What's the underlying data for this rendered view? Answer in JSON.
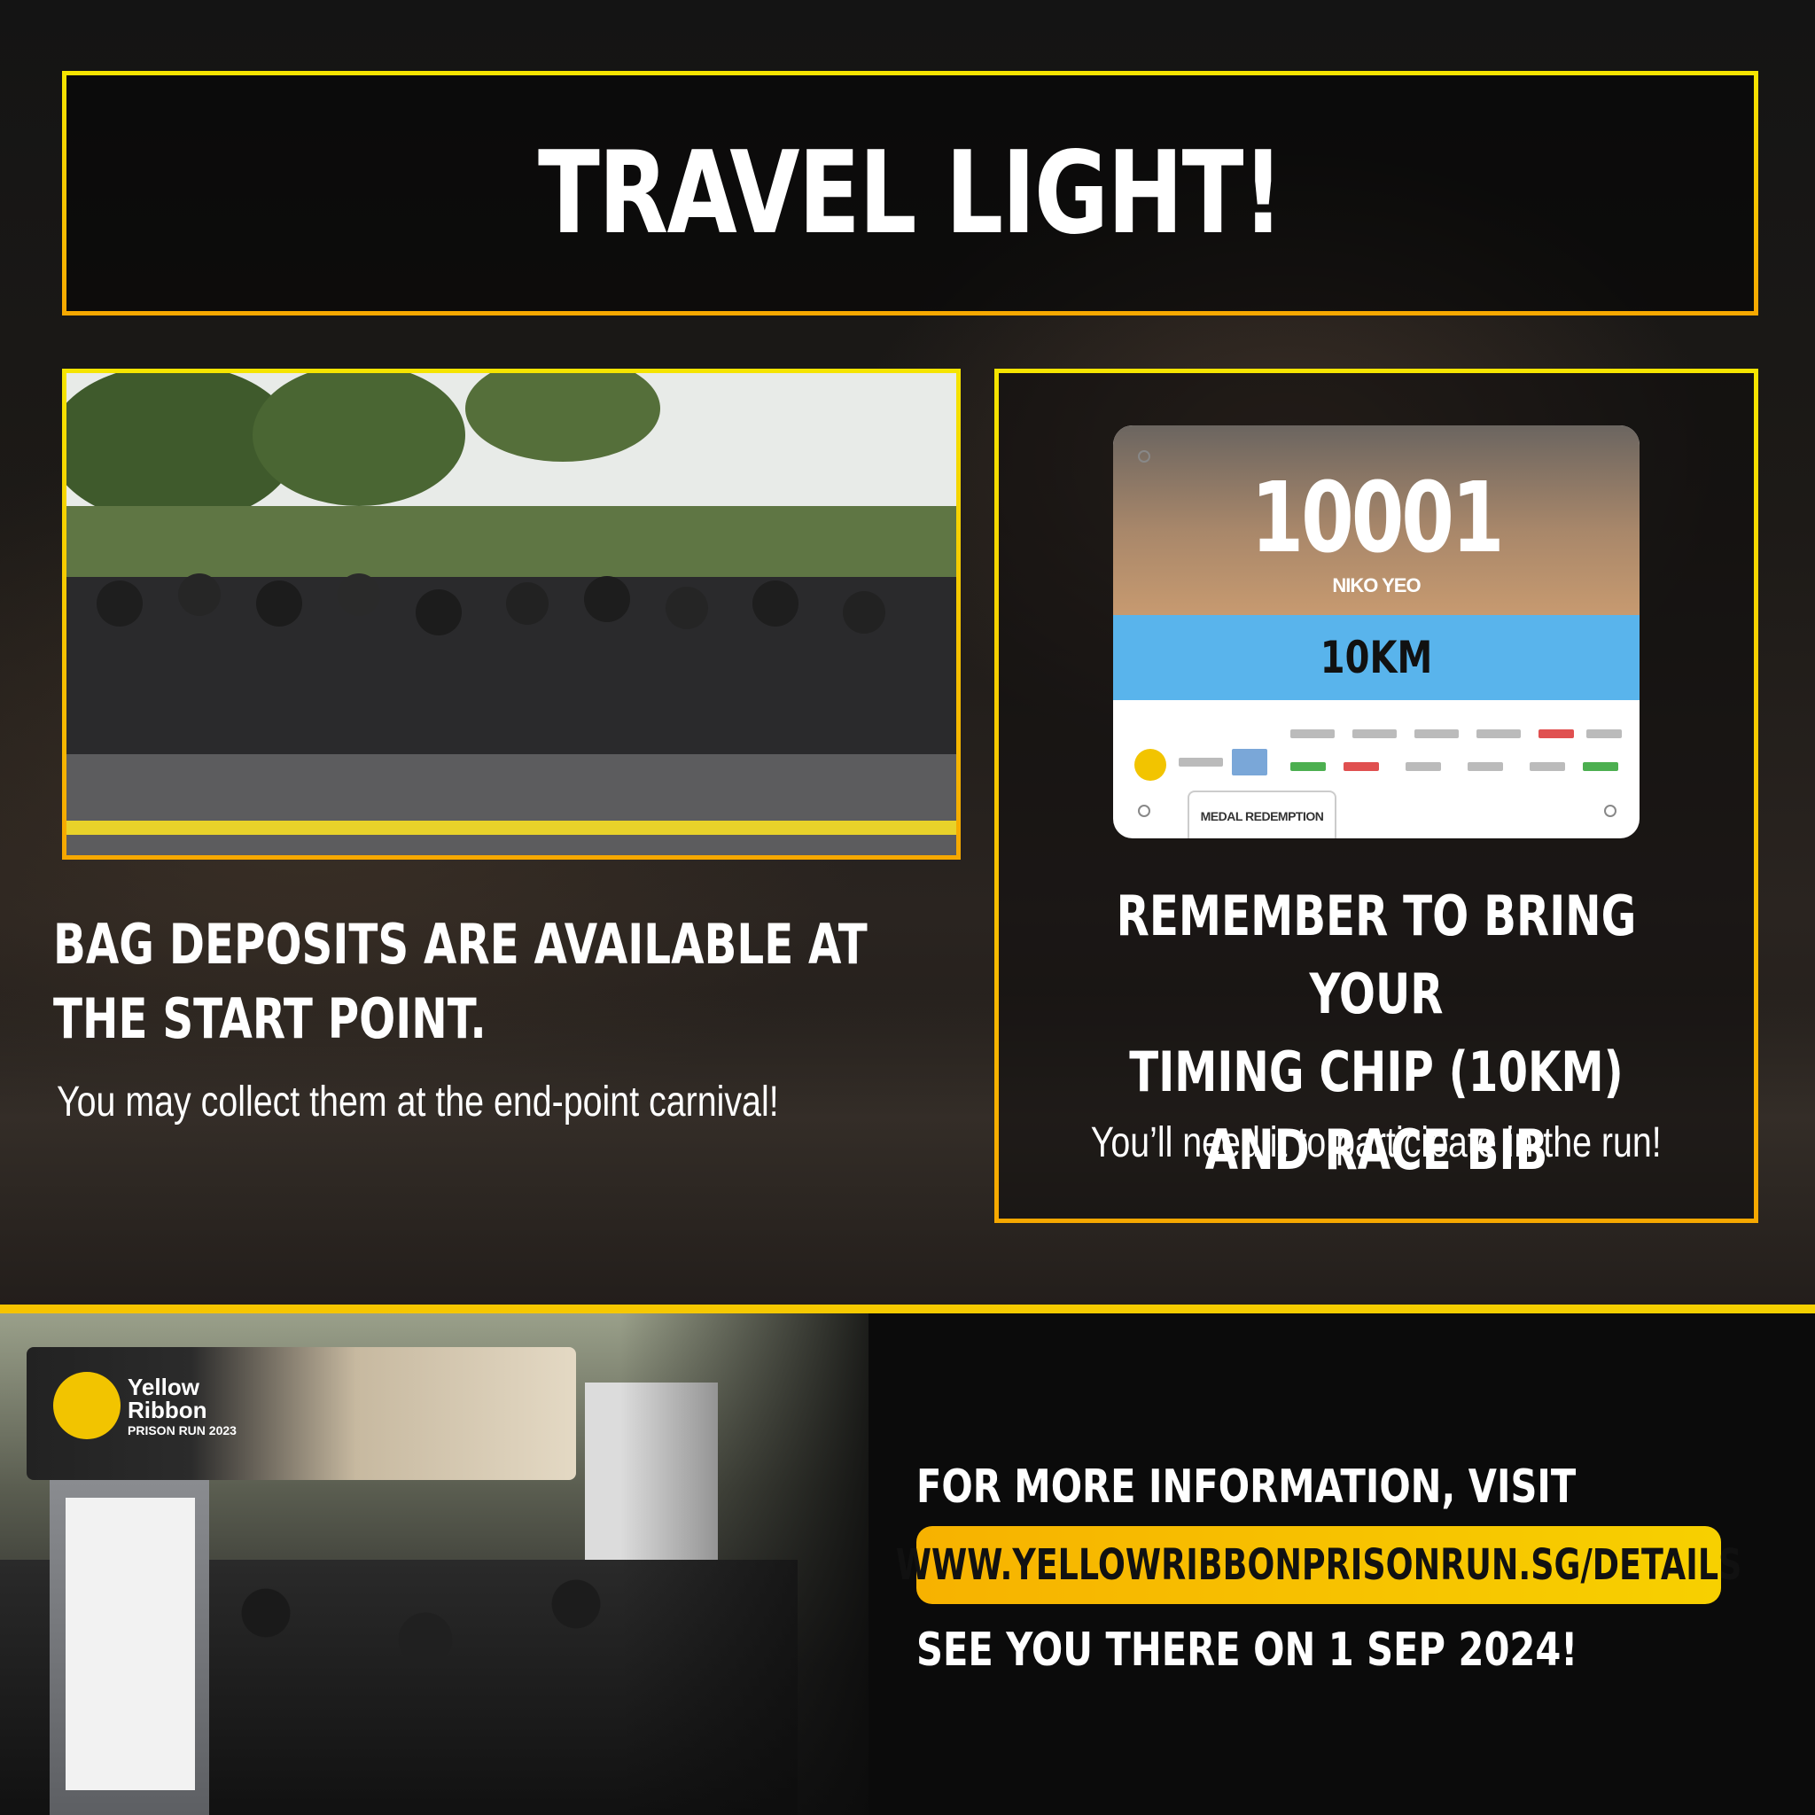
{
  "title": "TRAVEL LIGHT!",
  "bag": {
    "heading_line1": "BAG DEPOSITS ARE AVAILABLE AT",
    "heading_line2": "THE START POINT.",
    "subtext": "You may collect them at the end-point carnival!"
  },
  "bib_card": {
    "number": "10001",
    "name": "NIKO YEO",
    "distance": "10KM",
    "tab_label": "MEDAL REDEMPTION"
  },
  "chip": {
    "heading_line1": "REMEMBER TO BRING YOUR",
    "heading_line2": "TIMING CHIP (10KM)",
    "heading_line3": "AND RACE BIB",
    "subtext": "You’ll need it to participate in the run!"
  },
  "footer": {
    "info_line": "FOR MORE INFORMATION, VISIT",
    "url": "WWW.YELLOWRIBBONPRISONRUN.SG/DETAILS",
    "closing_line": "SEE YOU THERE ON 1 SEP 2024!"
  },
  "arch_sign": {
    "brand_line1": "Yellow",
    "brand_line2": "Ribbon",
    "brand_line3": "PRISON RUN 2023"
  },
  "colors": {
    "accent_yellow": "#f7c400",
    "bib_band_blue": "#59b4ec"
  }
}
